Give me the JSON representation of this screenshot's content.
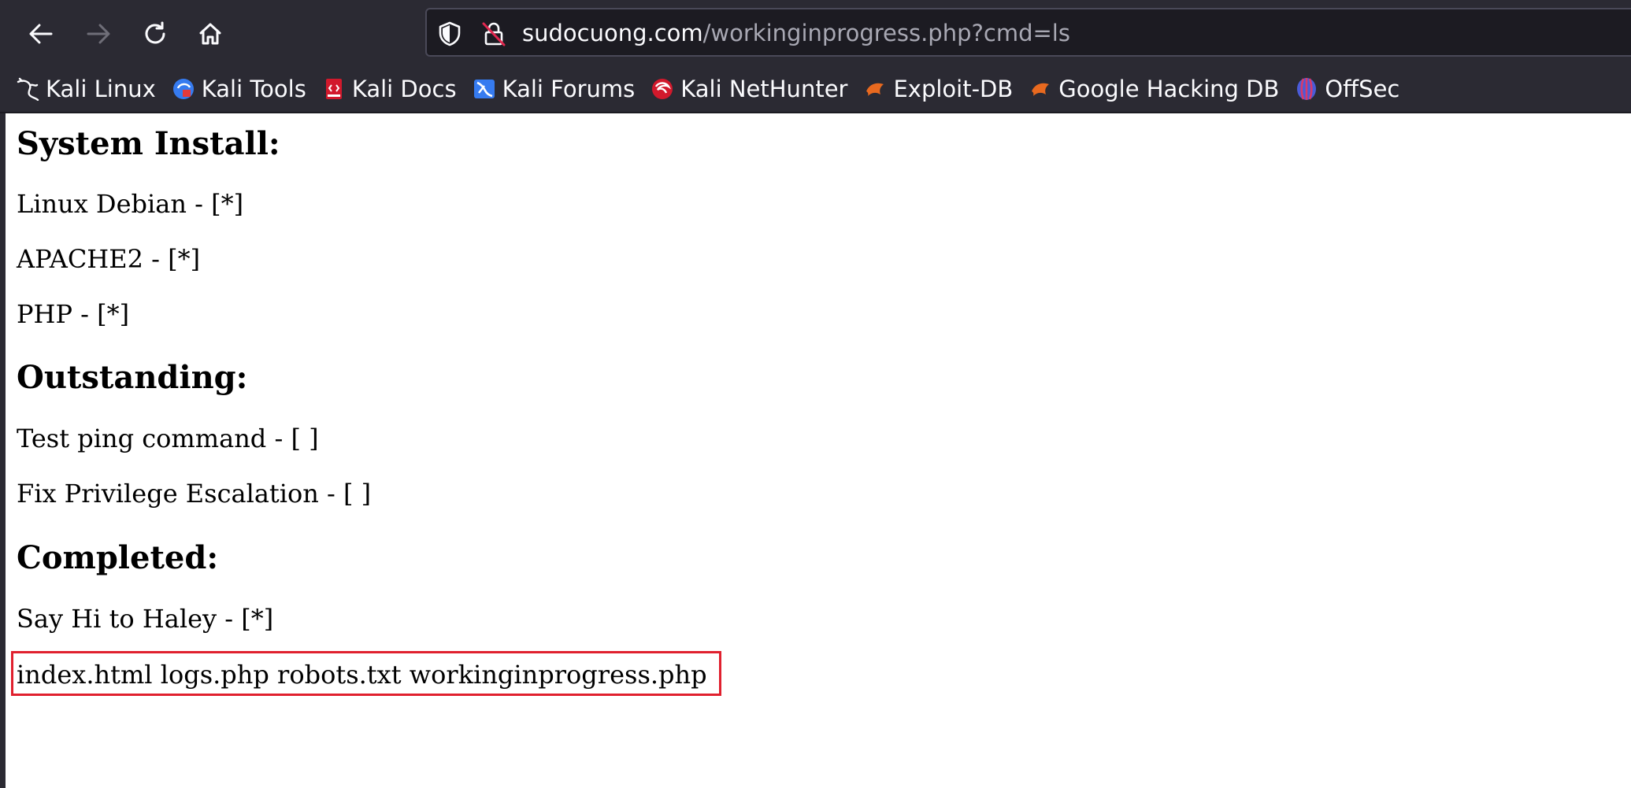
{
  "browser": {
    "nav": {
      "back_icon": "arrow-left-icon",
      "forward_icon": "arrow-right-icon",
      "reload_icon": "reload-icon",
      "home_icon": "home-icon"
    },
    "url_bar": {
      "domain": "sudocuong.com",
      "path": "/workinginprogress.php?cmd=ls",
      "shield_icon": "shield-icon",
      "lock_icon": "insecure-lock-icon"
    },
    "bookmarks": [
      {
        "label": "Kali Linux",
        "icon": "kali-dragon-icon"
      },
      {
        "label": "Kali Tools",
        "icon": "kali-tools-icon"
      },
      {
        "label": "Kali Docs",
        "icon": "kali-docs-icon"
      },
      {
        "label": "Kali Forums",
        "icon": "kali-forums-icon"
      },
      {
        "label": "Kali NetHunter",
        "icon": "nethunter-icon"
      },
      {
        "label": "Exploit-DB",
        "icon": "exploit-db-icon"
      },
      {
        "label": "Google Hacking DB",
        "icon": "ghdb-icon"
      },
      {
        "label": "OffSec",
        "icon": "offsec-icon"
      }
    ],
    "colors": {
      "toolbar_bg": "#2b2a33",
      "urlbar_bg": "#1c1b22",
      "text": "#fbfbfe",
      "path_text": "#a8a8b3",
      "highlight_box": "#e0202e"
    }
  },
  "page": {
    "sections": [
      {
        "heading": "System Install:",
        "items": [
          "Linux Debian - [*]",
          "APACHE2 - [*]",
          "PHP - [*]"
        ]
      },
      {
        "heading": "Outstanding:",
        "items": [
          "Test ping command - [ ]",
          "Fix Privilege Escalation - [ ]"
        ]
      },
      {
        "heading": "Completed:",
        "items": [
          "Say Hi to Haley - [*]"
        ]
      }
    ],
    "command_output": "index.html logs.php robots.txt workinginprogress.php"
  }
}
